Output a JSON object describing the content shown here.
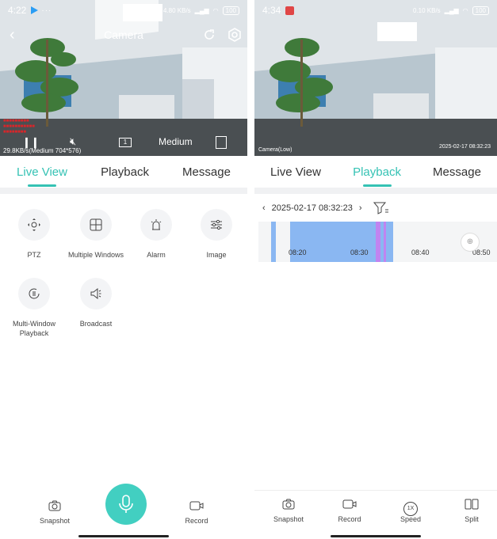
{
  "left": {
    "status": {
      "time": "4:22",
      "dots": "···",
      "battery": "100",
      "net": "4.80 KB/s"
    },
    "camera_tag": "Camera",
    "title": "Camera",
    "osd_text": "29.8KB/s(Medium 704*576)",
    "channel_count": "1",
    "quality": "Medium",
    "tabs": [
      "Live View",
      "Playback",
      "Message"
    ],
    "features": [
      {
        "label": "PTZ",
        "icon": "ptz-icon"
      },
      {
        "label": "Multiple Windows",
        "icon": "grid-icon"
      },
      {
        "label": "Alarm",
        "icon": "alarm-icon"
      },
      {
        "label": "Image",
        "icon": "sliders-icon"
      },
      {
        "label": "Multi-Window Playback",
        "icon": "playback-icon"
      },
      {
        "label": "Broadcast",
        "icon": "megaphone-icon"
      }
    ],
    "bottom": {
      "snapshot": "Snapshot",
      "record": "Record"
    }
  },
  "right": {
    "status": {
      "time": "4:34",
      "battery": "100",
      "net": "0.10 KB/s"
    },
    "camera_tag": "Camera",
    "cam_label": "Camera(Low)",
    "stamp": "2025-02-17 08:32:23",
    "tabs": [
      "Live View",
      "Playback",
      "Message"
    ],
    "date": "2025-02-17 08:32:23",
    "timeline_ticks": [
      "08:20",
      "08:30",
      "08:40",
      "08:50"
    ],
    "bottom": {
      "snapshot": "Snapshot",
      "record": "Record",
      "speed": "Speed",
      "speed_badge": "1X",
      "split": "Split"
    }
  },
  "colors": {
    "accent": "#35c2b4",
    "mic": "#42cfc1",
    "timeline_blue": "#8ab7f2",
    "timeline_pink": "#c084f0"
  }
}
